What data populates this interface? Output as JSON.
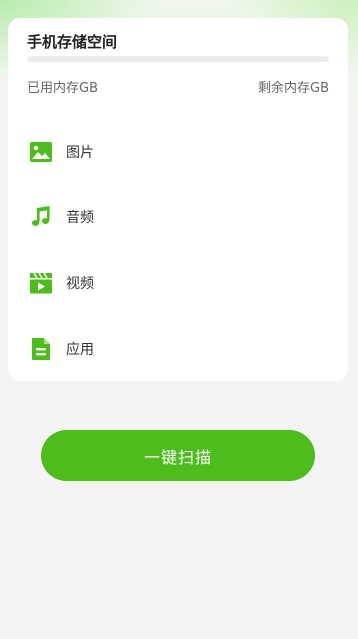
{
  "storage": {
    "title": "手机存储空间",
    "used_label": "已用内存GB",
    "remaining_label": "剩余内存GB",
    "used_fraction": 0
  },
  "categories": [
    {
      "label": "图片",
      "icon": "image-icon"
    },
    {
      "label": "音频",
      "icon": "music-note-icon"
    },
    {
      "label": "视频",
      "icon": "video-icon"
    },
    {
      "label": "应用",
      "icon": "app-file-icon"
    }
  ],
  "actions": {
    "scan_label": "一键扫描"
  },
  "colors": {
    "accent": "#4cbd1c",
    "background": "#f4f4f4",
    "card": "#ffffff"
  }
}
